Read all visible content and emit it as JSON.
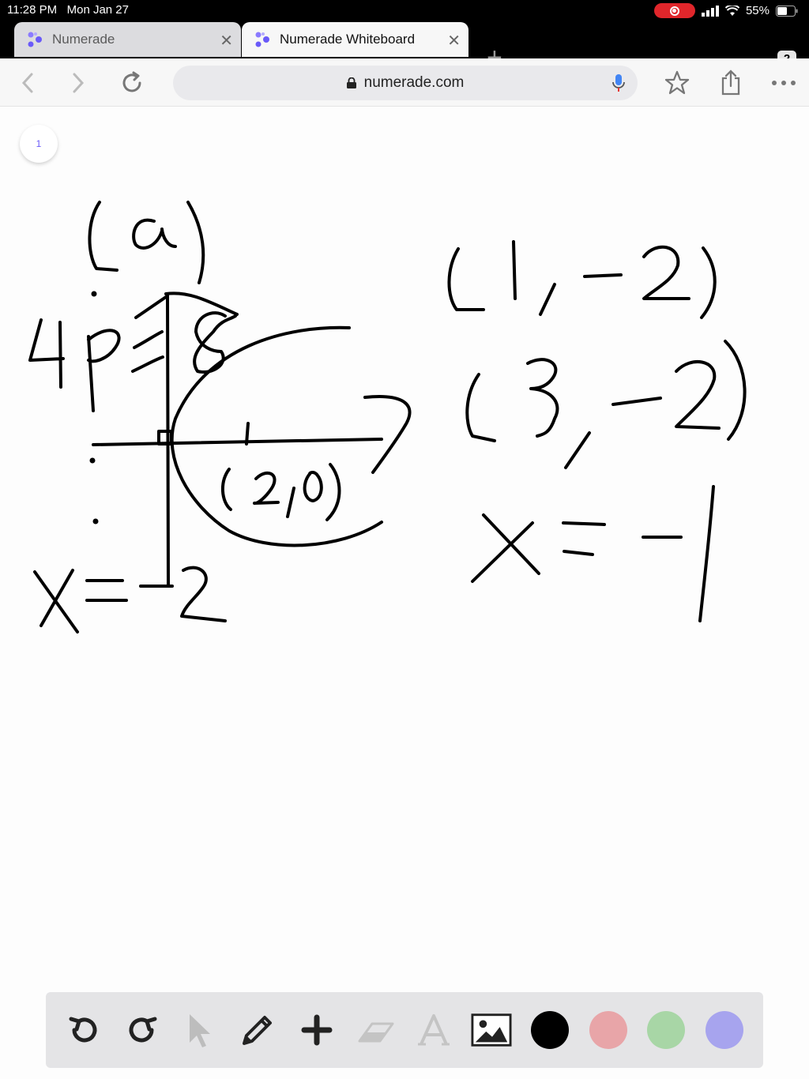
{
  "status": {
    "time": "11:28 PM",
    "date": "Mon Jan 27",
    "battery": "55%"
  },
  "tabs": [
    {
      "title": "Numerade",
      "active": false
    },
    {
      "title": "Numerade Whiteboard",
      "active": true
    }
  ],
  "tab_count": "2",
  "address": {
    "url": "numerade.com"
  },
  "page_number": "1",
  "toolbar": {
    "tools": [
      "undo-icon",
      "redo-icon",
      "pointer-icon",
      "pencil-icon",
      "add-icon",
      "eraser-icon",
      "text-icon",
      "image-icon"
    ],
    "colors": [
      "#000000",
      "#e8a5a8",
      "#a8d6a6",
      "#a7a4ee"
    ]
  },
  "colors": {
    "brand": "#6a5af9",
    "recording": "#e0262b"
  }
}
